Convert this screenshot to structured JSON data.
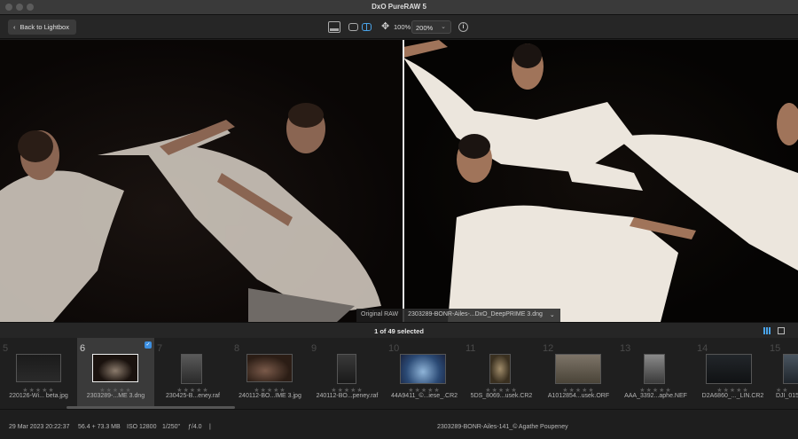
{
  "window": {
    "title": "DxO PureRAW 5"
  },
  "toolbar": {
    "back_label": "Back to Lightbox",
    "zoom_fit": "100%",
    "zoom_select": "200%"
  },
  "viewer": {
    "left_label": "Original RAW",
    "right_label": "2303289-BONR-Ailes-...DxO_DeepPRIME 3.dng"
  },
  "filmstrip": {
    "selected_count": "1 of 49 selected",
    "items": [
      {
        "num": "5",
        "name": "220126-Wi... beta.jpg",
        "stars": "★★★★★"
      },
      {
        "num": "6",
        "name": "2303289-...ME 3.dng",
        "stars": "★★★★★"
      },
      {
        "num": "7",
        "name": "230425-B...eney.raf",
        "stars": "★★★★★"
      },
      {
        "num": "8",
        "name": "240112-BO...IME 3.jpg",
        "stars": "★★★★★"
      },
      {
        "num": "9",
        "name": "240112-BO...peney.raf",
        "stars": "★★★★★"
      },
      {
        "num": "10",
        "name": "44A9411_©...iese_.CR2",
        "stars": "★★★★★"
      },
      {
        "num": "11",
        "name": "5DS_8069...usek.CR2",
        "stars": "★★★★★"
      },
      {
        "num": "12",
        "name": "A1012854...usek.ORF",
        "stars": "★★★★★"
      },
      {
        "num": "13",
        "name": "AAA_3392...aphe.NEF",
        "stars": "★★★★★"
      },
      {
        "num": "14",
        "name": "D2A6860_..._LIN.CR2",
        "stars": "★★★★★"
      },
      {
        "num": "15",
        "name": "DJI_015",
        "stars": "★★"
      }
    ]
  },
  "status": {
    "date": "29 Mar 2023 20:22:37",
    "size": "56.4 + 73.3 MB",
    "iso": "ISO 12800",
    "shutter": "1/250\"",
    "aperture": "ƒ/4.0",
    "sep": "|",
    "caption": "2303289-BONR-Ailes-141_© Agathe Poupeney"
  },
  "colors": {
    "accent": "#4aa3e8",
    "active_cell": "#3a3a3a"
  }
}
